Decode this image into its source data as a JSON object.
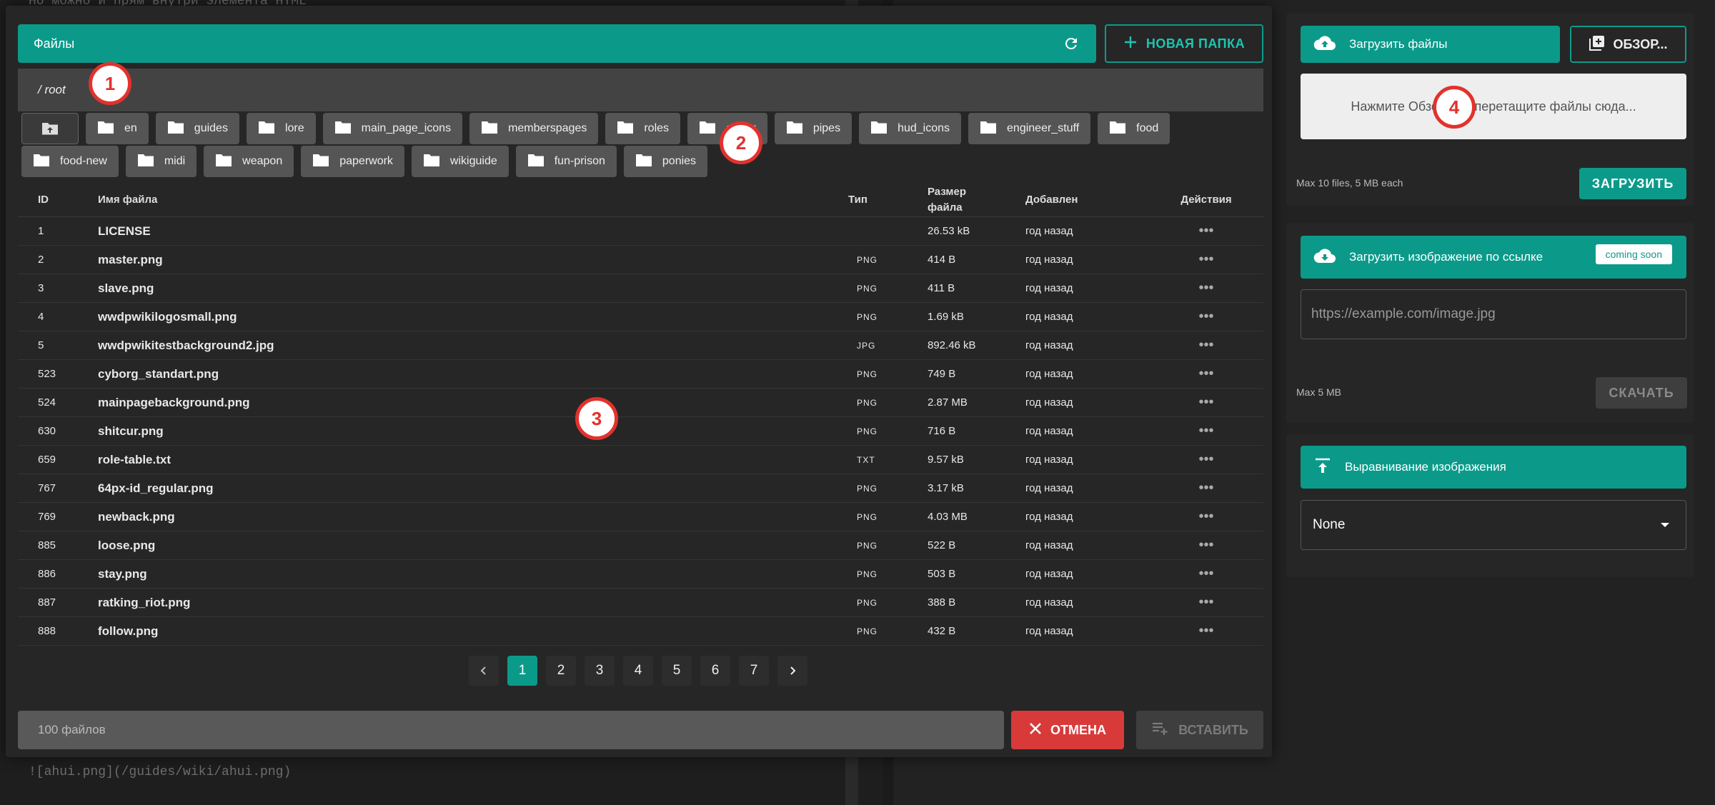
{
  "background": {
    "top_code": "Но можно и прям внутри элемента HTML",
    "bottom_code": "![ahui.png](/guides/wiki/ahui.png)"
  },
  "file_browser": {
    "title": "Файлы",
    "new_folder_label": "НОВАЯ ПАПКА",
    "path": "/ root",
    "folders_row1": [
      "en",
      "guides",
      "lore",
      "main_page_icons",
      "memberspages",
      "roles",
      "armor",
      "pipes",
      "hud_icons",
      "engineer_stuff",
      "food"
    ],
    "folders_row2": [
      "food-new",
      "midi",
      "weapon",
      "paperwork",
      "wikiguide",
      "fun-prison",
      "ponies"
    ],
    "columns": {
      "id": "ID",
      "name": "Имя файла",
      "type": "Тип",
      "size": "Размер файла",
      "added": "Добавлен",
      "actions": "Действия"
    },
    "rows": [
      {
        "id": "1",
        "name": "LICENSE",
        "type": "",
        "size": "26.53 kB",
        "added": "год назад"
      },
      {
        "id": "2",
        "name": "master.png",
        "type": "PNG",
        "size": "414 B",
        "added": "год назад"
      },
      {
        "id": "3",
        "name": "slave.png",
        "type": "PNG",
        "size": "411 B",
        "added": "год назад"
      },
      {
        "id": "4",
        "name": "wwdpwikilogosmall.png",
        "type": "PNG",
        "size": "1.69 kB",
        "added": "год назад"
      },
      {
        "id": "5",
        "name": "wwdpwikitestbackground2.jpg",
        "type": "JPG",
        "size": "892.46 kB",
        "added": "год назад"
      },
      {
        "id": "523",
        "name": "cyborg_standart.png",
        "type": "PNG",
        "size": "749 B",
        "added": "год назад"
      },
      {
        "id": "524",
        "name": "mainpagebackground.png",
        "type": "PNG",
        "size": "2.87 MB",
        "added": "год назад"
      },
      {
        "id": "630",
        "name": "shitcur.png",
        "type": "PNG",
        "size": "716 B",
        "added": "год назад"
      },
      {
        "id": "659",
        "name": "role-table.txt",
        "type": "TXT",
        "size": "9.57 kB",
        "added": "год назад"
      },
      {
        "id": "767",
        "name": "64px-id_regular.png",
        "type": "PNG",
        "size": "3.17 kB",
        "added": "год назад"
      },
      {
        "id": "769",
        "name": "newback.png",
        "type": "PNG",
        "size": "4.03 MB",
        "added": "год назад"
      },
      {
        "id": "885",
        "name": "loose.png",
        "type": "PNG",
        "size": "522 B",
        "added": "год назад"
      },
      {
        "id": "886",
        "name": "stay.png",
        "type": "PNG",
        "size": "503 B",
        "added": "год назад"
      },
      {
        "id": "887",
        "name": "ratking_riot.png",
        "type": "PNG",
        "size": "388 B",
        "added": "год назад"
      },
      {
        "id": "888",
        "name": "follow.png",
        "type": "PNG",
        "size": "432 B",
        "added": "год назад"
      }
    ],
    "actions_glyph": "•••",
    "pages": [
      "1",
      "2",
      "3",
      "4",
      "5",
      "6",
      "7"
    ],
    "current_page": "1",
    "count_text": "100 файлов",
    "cancel_label": "ОТМЕНА",
    "insert_label": "ВСТАВИТЬ"
  },
  "upload_panel": {
    "upload_files_label": "Загрузить файлы",
    "browse_label": "ОБЗОР...",
    "dropzone_text": "Нажмите Обзор или перетащите файлы сюда...",
    "limit_note": "Max 10 files, 5 MB each",
    "upload_button": "ЗАГРУЗИТЬ"
  },
  "url_panel": {
    "title": "Загрузить изображение по ссылке",
    "badge": "coming soon",
    "placeholder": "https://example.com/image.jpg",
    "limit_note": "Max 5 MB",
    "download_button": "СКАЧАТЬ"
  },
  "align_panel": {
    "title": "Выравнивание изображения",
    "selected": "None"
  },
  "markers": [
    "1",
    "2",
    "3",
    "4"
  ],
  "colors": {
    "accent": "#0b9a8a",
    "danger": "#d83a3a",
    "marker": "#e2322d"
  }
}
